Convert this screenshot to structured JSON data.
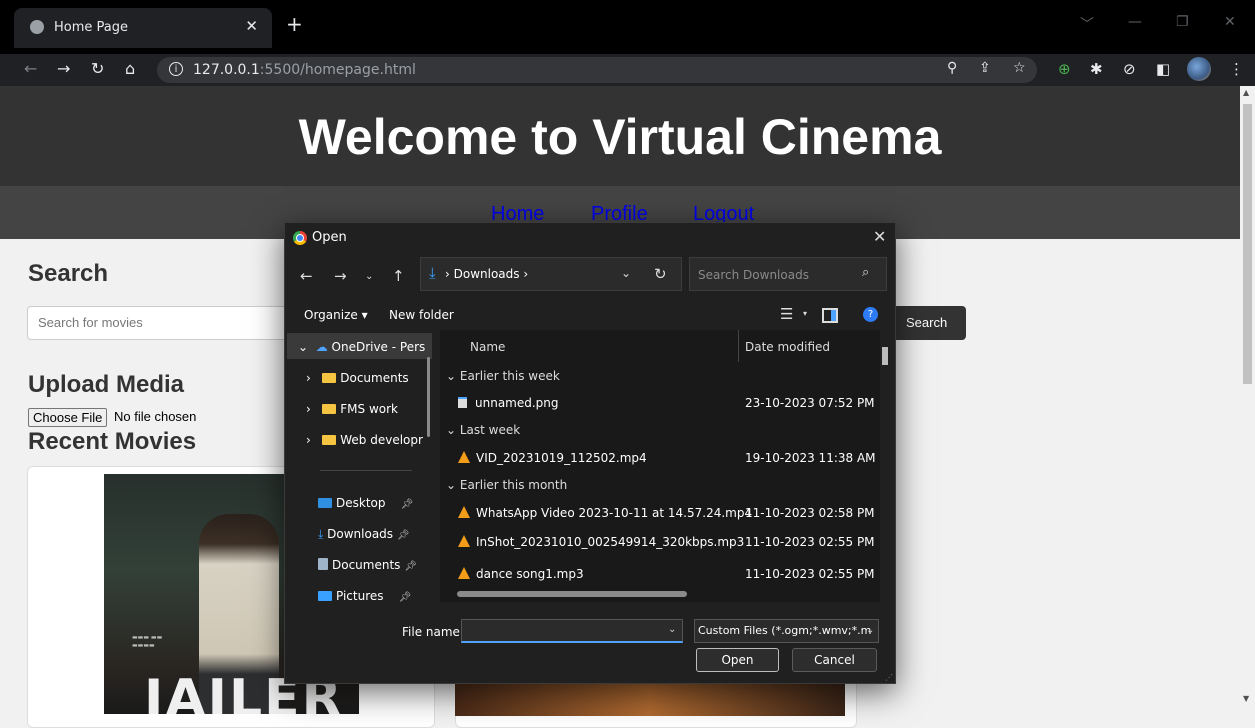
{
  "browser": {
    "tab_title": "Home Page",
    "tab_close": "✕",
    "new_tab": "+",
    "url_host": "127.0.0.1",
    "url_rest": ":5500/homepage.html",
    "window_controls": [
      "﹀",
      "—",
      "❐",
      "✕"
    ]
  },
  "site": {
    "title": "Welcome to Virtual Cinema",
    "nav": [
      "Home",
      "Profile",
      "Logout"
    ],
    "search_heading": "Search",
    "search_placeholder": "Search for movies",
    "search_button": "Search",
    "upload_heading": "Upload Media",
    "choose_file": "Choose File",
    "no_file": "No file chosen",
    "recent_heading": "Recent Movies",
    "poster_title": "JAILER"
  },
  "dialog": {
    "title": "Open",
    "path": "Downloads",
    "search_placeholder": "Search Downloads",
    "organize": "Organize ▾",
    "new_folder": "New folder",
    "nav_pane": [
      "OneDrive - Pers",
      "Documents",
      "FMS work",
      "Web developr",
      "Desktop",
      "Downloads",
      "Documents",
      "Pictures"
    ],
    "columns": {
      "name": "Name",
      "date": "Date modified"
    },
    "groups": [
      "Earlier this week",
      "Last week",
      "Earlier this month"
    ],
    "files": [
      {
        "name": "unnamed.png",
        "date": "23-10-2023 07:52 PM",
        "icon": "png-icon"
      },
      {
        "name": "VID_20231019_112502.mp4",
        "date": "19-10-2023 11:38 AM",
        "icon": "vlc-icon"
      },
      {
        "name": "WhatsApp Video 2023-10-11 at 14.57.24.mp4",
        "date": "11-10-2023 02:58 PM",
        "icon": "vlc-icon"
      },
      {
        "name": "InShot_20231010_002549914_320kbps.mp3",
        "date": "11-10-2023 02:55 PM",
        "icon": "vlc-icon"
      },
      {
        "name": "dance song1.mp3",
        "date": "11-10-2023 02:55 PM",
        "icon": "vlc-icon"
      }
    ],
    "file_name_label": "File name:",
    "file_name_value": "",
    "file_type": "Custom Files (*.ogm;*.wmv;*.m",
    "open_button": "Open",
    "cancel_button": "Cancel"
  },
  "colors": {
    "header": "#333333",
    "nav": "#444444",
    "link": "#0000ee",
    "dialog_bg": "#202020"
  }
}
